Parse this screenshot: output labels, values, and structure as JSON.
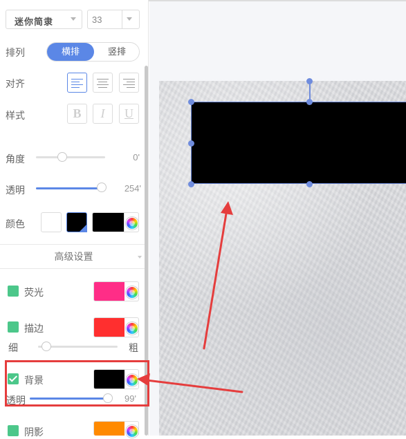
{
  "font_select": {
    "value": "迷你简隶"
  },
  "size_select": {
    "value": "33"
  },
  "arrange": {
    "label": "排列",
    "options": [
      "横排",
      "竖排"
    ],
    "selected": "横排"
  },
  "align": {
    "label": "对齐",
    "selected": "left"
  },
  "style": {
    "label": "样式",
    "bold": "B",
    "italic": "I",
    "underline": "U"
  },
  "angle": {
    "label": "角度",
    "value": "0'",
    "fraction": 0.38
  },
  "opacity": {
    "label": "透明",
    "value": "254'",
    "fraction": 1.0
  },
  "color": {
    "label": "颜色",
    "value_color": "#000000"
  },
  "advanced": {
    "title": "高级设置"
  },
  "glow": {
    "label": "荧光",
    "checked": false,
    "color": "#ff2d87"
  },
  "stroke": {
    "label": "描边",
    "checked": false,
    "color": "#ff2f2f",
    "thin_label": "细",
    "thick_label": "粗",
    "fraction": 0.1
  },
  "background": {
    "label": "背景",
    "checked": true,
    "color": "#000000",
    "opacity_label": "透明",
    "opacity_value": "99'",
    "fraction": 0.97
  },
  "shadow": {
    "label": "阴影",
    "checked": false,
    "color": "#ff8a00"
  },
  "colors": {
    "accent": "#5b87e6",
    "check": "#4cc78a",
    "annotation": "#e53d3d"
  }
}
